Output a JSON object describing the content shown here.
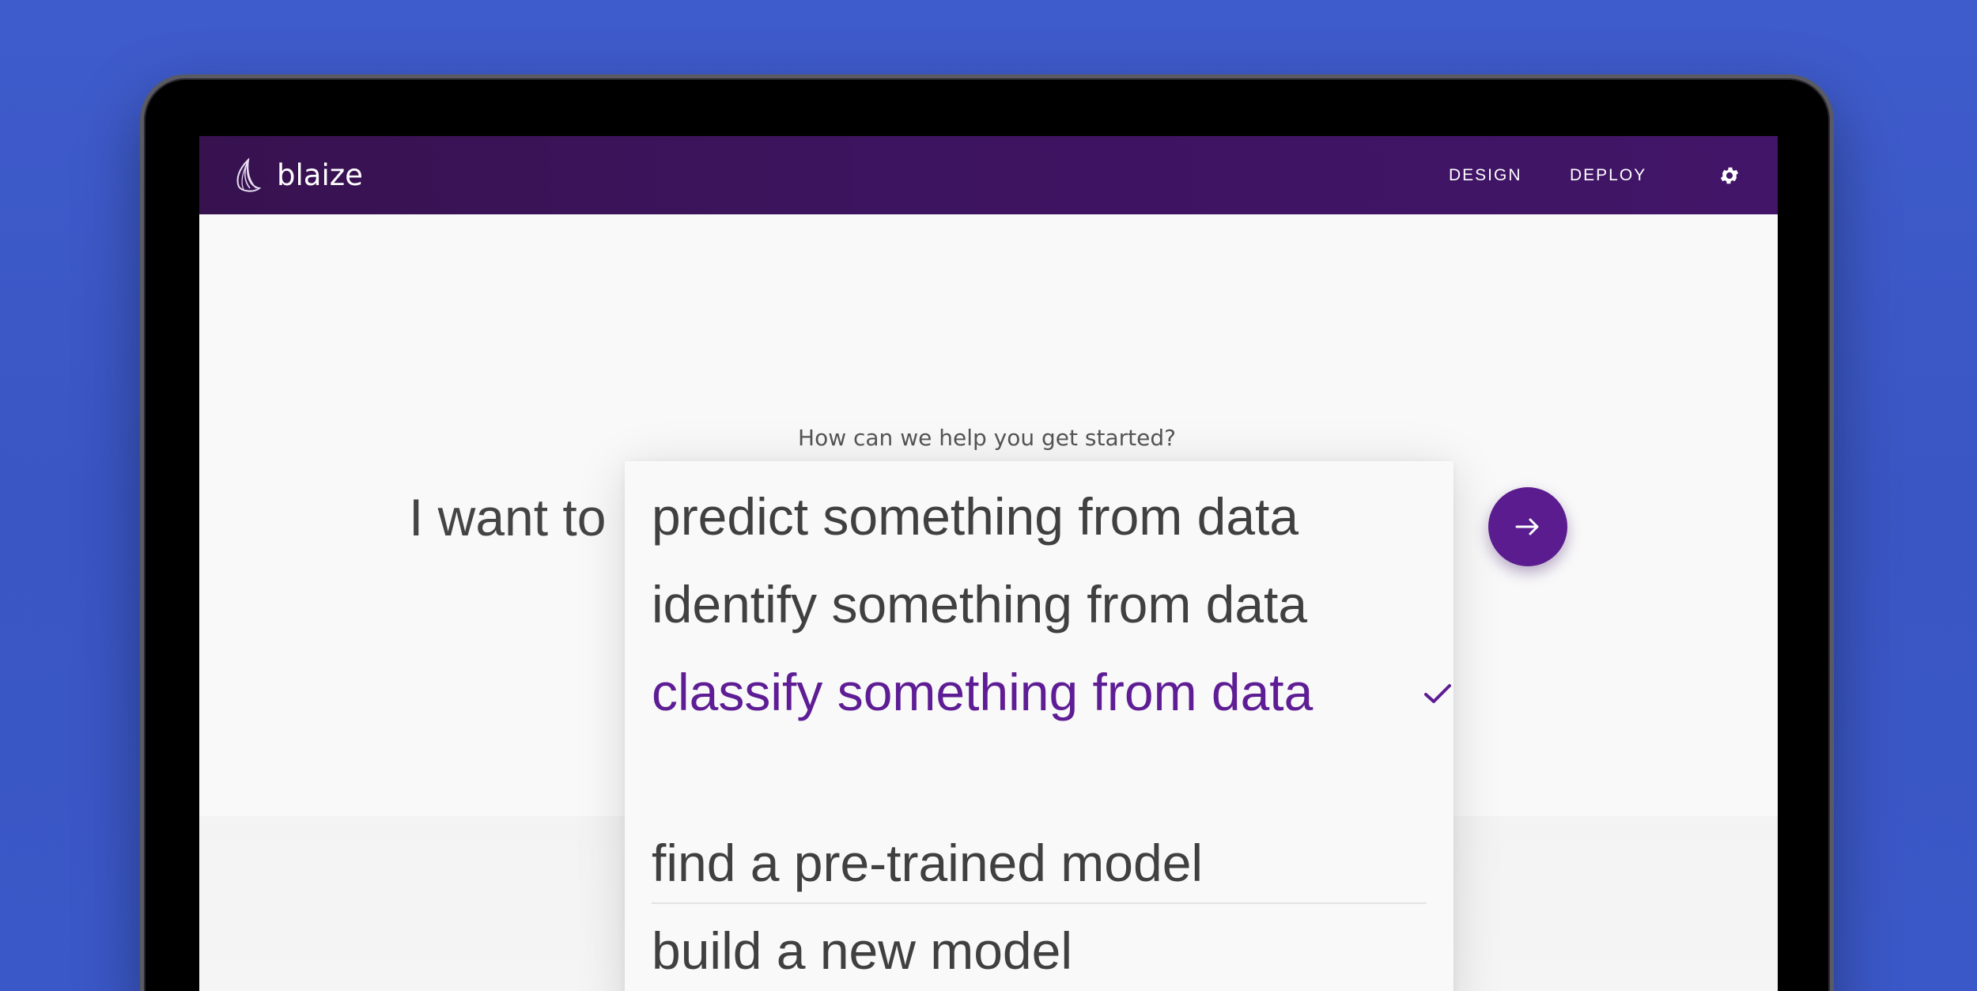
{
  "app": {
    "logo_text": "blaize"
  },
  "nav": {
    "links": [
      "DESIGN",
      "DEPLOY"
    ],
    "settings_icon": "gear-icon"
  },
  "main": {
    "prompt": "How can we help you get started?",
    "lead_text": "I want to",
    "go_icon": "arrow-right-icon"
  },
  "dropdown": {
    "options": [
      "predict something from data",
      "identify something from data",
      "classify something from data",
      "find a pre-trained model",
      "build a new model"
    ],
    "selected": "classify something from data",
    "check_icon": "check-icon"
  },
  "colors": {
    "background": "#3f5ccc",
    "navbar": "#3d1460",
    "accent": "#5e1d94",
    "text": "#404040"
  }
}
